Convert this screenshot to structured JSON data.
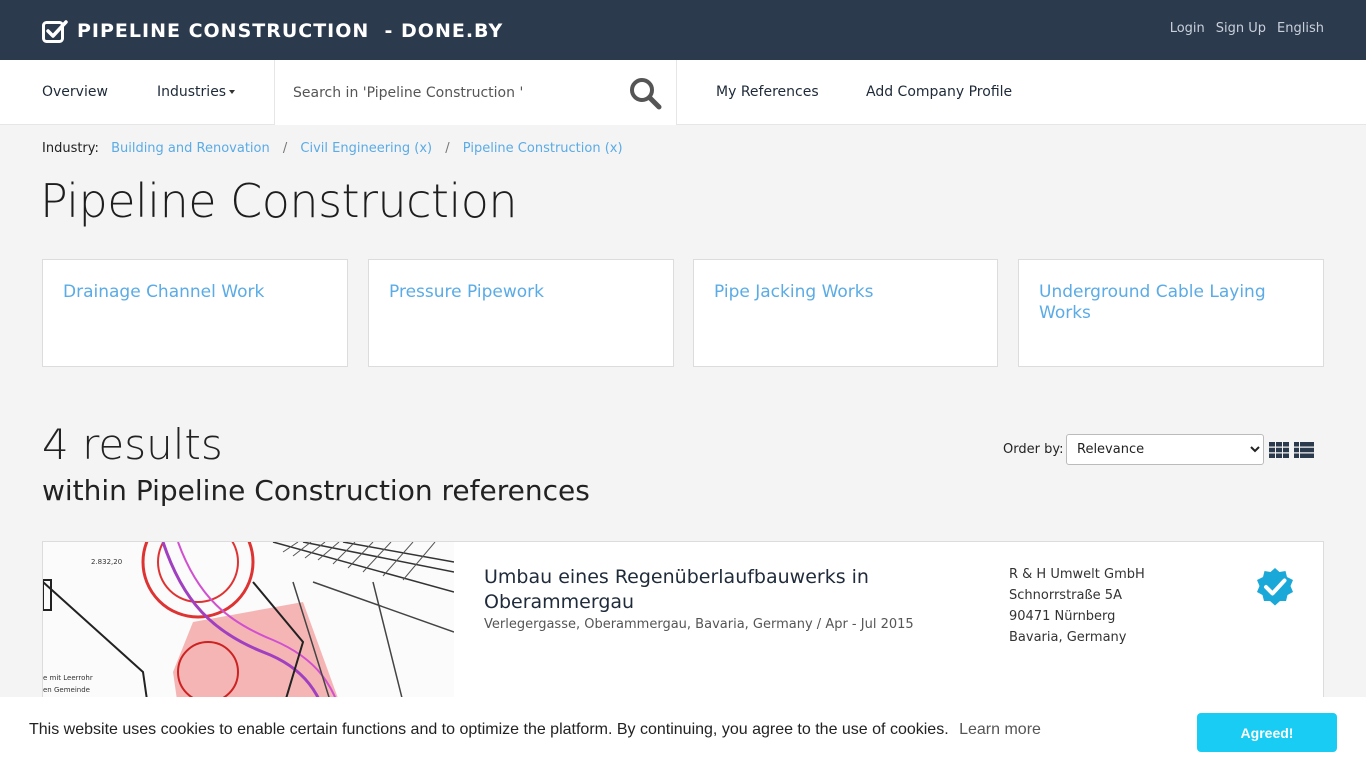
{
  "header": {
    "brand": "PIPELINE CONSTRUCTION  - DONE.BY",
    "links": {
      "login": "Login",
      "signup": "Sign Up",
      "language": "English"
    },
    "brand_color": "#2c3a4e"
  },
  "nav": {
    "overview": "Overview",
    "industries": "Industries",
    "search_placeholder": "Search in 'Pipeline Construction '",
    "my_references": "My References",
    "add_company": "Add Company Profile"
  },
  "breadcrumb": {
    "label": "Industry:",
    "items": [
      "Building and Renovation",
      "Civil Engineering (x)",
      "Pipeline Construction (x)"
    ],
    "separator": "/"
  },
  "page_title": "Pipeline Construction",
  "categories": [
    "Drainage Channel Work",
    "Pressure Pipework",
    "Pipe Jacking Works",
    "Underground Cable Laying Works"
  ],
  "results": {
    "count": "4 results",
    "subtitle": "within Pipeline Construction references",
    "order_label": "Order by:",
    "order_selected": "Relevance"
  },
  "result_items": [
    {
      "title": "Umbau eines Regenüberlaufbauwerks in Oberammergau",
      "meta": "Verlegergasse, Oberammergau, Bavaria, Germany / Apr - Jul 2015",
      "company": {
        "name": "R & H Umwelt GmbH",
        "street": "Schnorrstraße 5A",
        "city": "90471 Nürnberg",
        "region": "Bavaria, Germany"
      },
      "verified_icon": "verified-badge-icon"
    }
  ],
  "cookie": {
    "text": "This website uses cookies to enable certain functions and to optimize the platform. By continuing, you agree to the use of cookies.",
    "learn_more": "Learn more",
    "button": "Agreed!",
    "button_color": "#19ccf4"
  },
  "colors": {
    "link": "#5aabe6",
    "verified": "#1aa8d8"
  }
}
